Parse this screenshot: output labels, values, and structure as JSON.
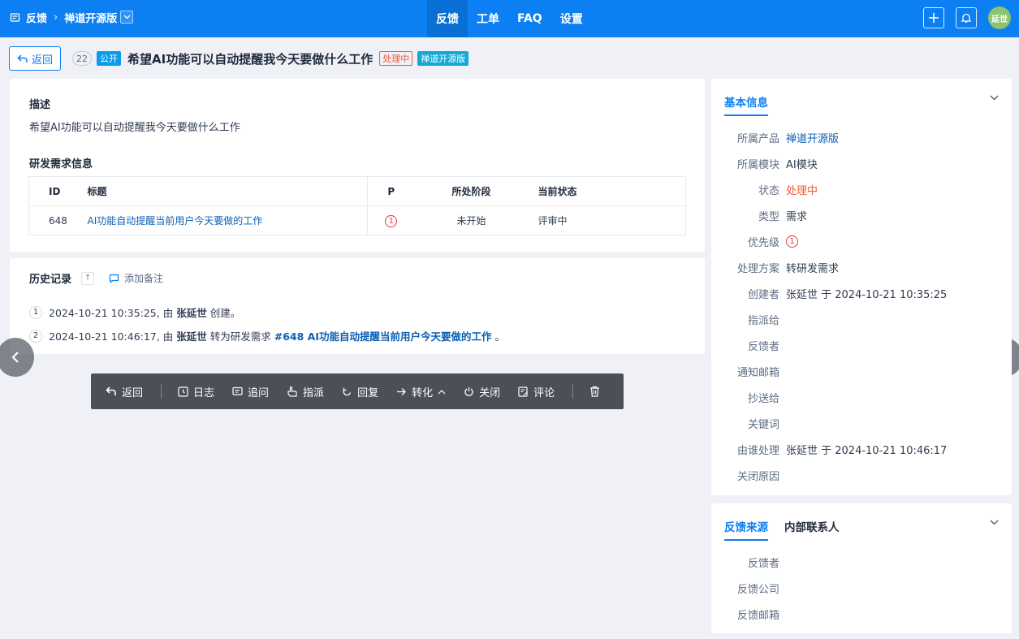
{
  "header": {
    "breadcrumb_app": "反馈",
    "breadcrumb_product": "禅道开源版",
    "nav_tabs": [
      "反馈",
      "工单",
      "FAQ",
      "设置"
    ],
    "avatar_text": "延世"
  },
  "feedback": {
    "back_label": "返回",
    "id": "22",
    "public_tag": "公开",
    "title": "希望AI功能可以自动提醒我今天要做什么工作",
    "status_tag": "处理中",
    "product_tag": "禅道开源版"
  },
  "description": {
    "heading": "描述",
    "text": "希望AI功能可以自动提醒我今天要做什么工作"
  },
  "rd_info": {
    "heading": "研发需求信息",
    "columns": [
      "ID",
      "标题",
      "P",
      "所处阶段",
      "当前状态"
    ],
    "rows": [
      {
        "id": "648",
        "title": "AI功能自动提醒当前用户今天要做的工作",
        "priority": "1",
        "stage": "未开始",
        "status": "评审中"
      }
    ]
  },
  "history": {
    "heading": "历史记录",
    "add_note": "添加备注",
    "items": [
      {
        "num": "1",
        "time": "2024-10-21 10:35:25, 由",
        "actor": "张延世",
        "action": "创建。"
      },
      {
        "num": "2",
        "time": "2024-10-21 10:46:17, 由",
        "actor": "张延世",
        "action": "转为研发需求",
        "link": "#648 AI功能自动提醒当前用户今天要做的工作",
        "end": "。"
      }
    ]
  },
  "actions": {
    "back": "返回",
    "log": "日志",
    "ask": "追问",
    "assign": "指派",
    "reply": "回复",
    "convert": "转化",
    "close": "关闭",
    "comment": "评论"
  },
  "basic_info": {
    "tab": "基本信息",
    "rows": [
      {
        "label": "所属产品",
        "value": "禅道开源版"
      },
      {
        "label": "所属模块",
        "value": "AI模块"
      },
      {
        "label": "状态",
        "value": "处理中"
      },
      {
        "label": "类型",
        "value": "需求"
      },
      {
        "label": "优先级",
        "value": "1"
      },
      {
        "label": "处理方案",
        "value": "转研发需求"
      },
      {
        "label": "创建者",
        "value": "张延世 于 2024-10-21 10:35:25"
      },
      {
        "label": "指派给",
        "value": ""
      },
      {
        "label": "反馈者",
        "value": ""
      },
      {
        "label": "通知邮箱",
        "value": ""
      },
      {
        "label": "抄送给",
        "value": ""
      },
      {
        "label": "关键词",
        "value": ""
      },
      {
        "label": "由谁处理",
        "value": "张延世 于 2024-10-21 10:46:17"
      },
      {
        "label": "关闭原因",
        "value": ""
      }
    ]
  },
  "source_info": {
    "tabs": [
      "反馈来源",
      "内部联系人"
    ],
    "rows": [
      {
        "label": "反馈者",
        "value": ""
      },
      {
        "label": "反馈公司",
        "value": ""
      },
      {
        "label": "反馈邮箱",
        "value": ""
      }
    ]
  },
  "colors": {
    "brand": "#0c7ff2",
    "status_doing": "#f15a38",
    "link": "#0c5fb4"
  }
}
